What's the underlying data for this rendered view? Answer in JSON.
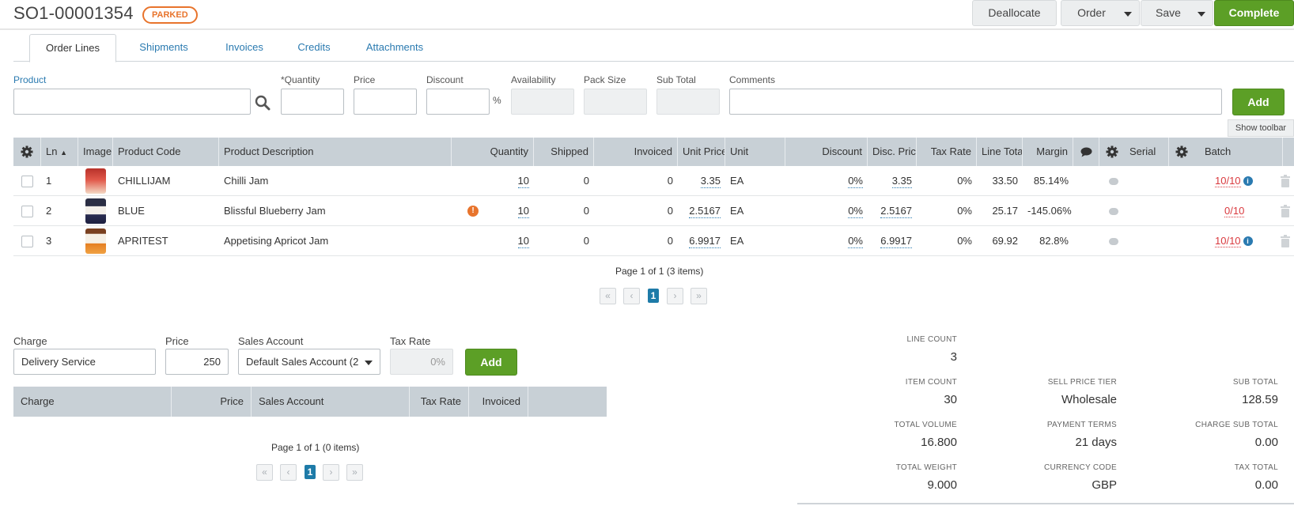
{
  "header": {
    "order_number": "SO1-00001354",
    "status": "PARKED",
    "buttons": {
      "deallocate": "Deallocate",
      "order": "Order",
      "save": "Save",
      "complete": "Complete"
    }
  },
  "tabs": [
    "Order Lines",
    "Shipments",
    "Invoices",
    "Credits",
    "Attachments"
  ],
  "entry": {
    "labels": {
      "product": "Product",
      "quantity": "*Quantity",
      "price": "Price",
      "discount": "Discount",
      "availability": "Availability",
      "pack_size": "Pack Size",
      "sub_total": "Sub Total",
      "comments": "Comments"
    },
    "percent": "%",
    "add": "Add",
    "show_toolbar": "Show toolbar"
  },
  "grid": {
    "columns": {
      "ln": "Ln",
      "image": "Image",
      "code": "Product Code",
      "desc": "Product Description",
      "qty": "Quantity",
      "shipped": "Shipped",
      "invoiced": "Invoiced",
      "unit_price": "Unit Price",
      "unit": "Unit",
      "discount": "Discount",
      "disc_price": "Disc. Price",
      "tax_rate": "Tax Rate",
      "line_total": "Line Total",
      "margin": "Margin",
      "serial": "Serial",
      "batch": "Batch"
    },
    "rows": [
      {
        "ln": "1",
        "code": "CHILLIJAM",
        "desc": "Chilli Jam",
        "qty": "10",
        "shipped": "0",
        "invoiced": "0",
        "unit_price": "3.35",
        "unit": "EA",
        "discount": "0%",
        "disc_price": "3.35",
        "tax_rate": "0%",
        "line_total": "33.50",
        "margin": "85.14%",
        "batch": "10/10",
        "warning": false,
        "batch_info": true
      },
      {
        "ln": "2",
        "code": "BLUE",
        "desc": "Blissful Blueberry Jam",
        "qty": "10",
        "shipped": "0",
        "invoiced": "0",
        "unit_price": "2.5167",
        "unit": "EA",
        "discount": "0%",
        "disc_price": "2.5167",
        "tax_rate": "0%",
        "line_total": "25.17",
        "margin": "-145.06%",
        "batch": "0/10",
        "warning": true,
        "batch_info": false
      },
      {
        "ln": "3",
        "code": "APRITEST",
        "desc": "Appetising Apricot Jam",
        "qty": "10",
        "shipped": "0",
        "invoiced": "0",
        "unit_price": "6.9917",
        "unit": "EA",
        "discount": "0%",
        "disc_price": "6.9917",
        "tax_rate": "0%",
        "line_total": "69.92",
        "margin": "82.8%",
        "batch": "10/10",
        "warning": false,
        "batch_info": true
      }
    ],
    "pager_text": "Page 1 of 1 (3 items)",
    "current_page": "1"
  },
  "charges": {
    "labels": {
      "charge": "Charge",
      "price": "Price",
      "sales_account": "Sales Account",
      "tax_rate": "Tax Rate"
    },
    "values": {
      "charge": "Delivery Service",
      "price": "250",
      "sales_account": "Default Sales Account (2",
      "tax_rate": "0%"
    },
    "add": "Add",
    "columns": {
      "charge": "Charge",
      "price": "Price",
      "sales_account": "Sales Account",
      "tax_rate": "Tax Rate",
      "invoiced": "Invoiced"
    },
    "pager_text": "Page 1 of 1 (0 items)",
    "current_page": "1"
  },
  "summary": {
    "line_count": {
      "label": "LINE COUNT",
      "value": "3"
    },
    "item_count": {
      "label": "ITEM COUNT",
      "value": "30"
    },
    "total_volume": {
      "label": "TOTAL VOLUME",
      "value": "16.800"
    },
    "total_weight": {
      "label": "TOTAL WEIGHT",
      "value": "9.000"
    },
    "sell_price_tier": {
      "label": "SELL PRICE TIER",
      "value": "Wholesale"
    },
    "payment_terms": {
      "label": "PAYMENT TERMS",
      "value": "21 days"
    },
    "currency_code": {
      "label": "CURRENCY CODE",
      "value": "GBP"
    },
    "sub_total": {
      "label": "SUB TOTAL",
      "value": "128.59"
    },
    "charge_sub_total": {
      "label": "CHARGE SUB TOTAL",
      "value": "0.00"
    },
    "tax_total": {
      "label": "TAX TOTAL",
      "value": "0.00"
    }
  },
  "colors": {
    "accent_blue": "#2a7ab0",
    "complete_green": "#5c9f26",
    "parked_orange": "#e8742c",
    "grid_header": "#c8d0d6"
  }
}
